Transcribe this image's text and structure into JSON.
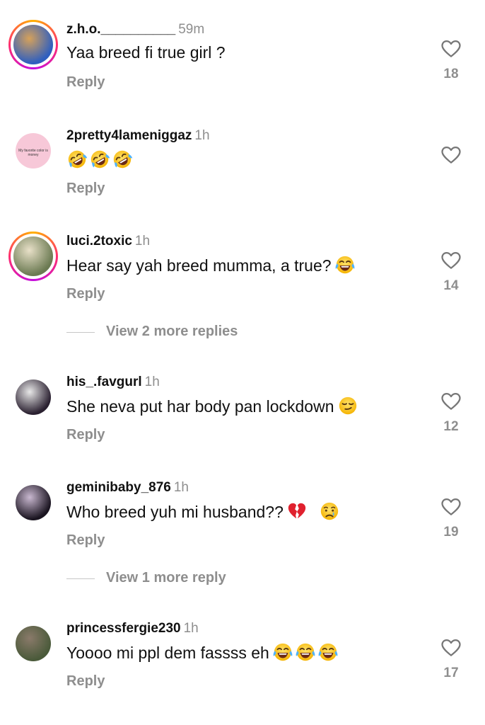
{
  "comments": [
    {
      "username": "z.h.o.__________",
      "time": "59m",
      "text": "Yaa breed fi true girl ?",
      "reply": "Reply",
      "likes": "18",
      "avatar_style": "story-ring",
      "avatar_colors": [
        "#2f5fbf",
        "#d6a15a"
      ]
    },
    {
      "username": "2pretty4lameniggaz",
      "time": "1h",
      "text": "",
      "emojis": [
        "rofl-emoji",
        "rofl-emoji",
        "rofl-emoji"
      ],
      "reply": "Reply",
      "likes": "",
      "avatar_style": "plain",
      "avatar_text": "My favorite color is money",
      "avatar_colors": [
        "#f7c8d8"
      ]
    },
    {
      "username": "luci.2toxic",
      "time": "1h",
      "text": "Hear say yah breed mumma, a true?",
      "emojis": [
        "laughing-tears-emoji"
      ],
      "reply": "Reply",
      "likes": "14",
      "avatar_style": "story-ring",
      "avatar_colors": [
        "#6b7a52",
        "#e8e0c8"
      ],
      "more_replies": "View 2 more replies"
    },
    {
      "username": "his_.favgurl",
      "time": "1h",
      "text": "She neva put har body pan lockdown",
      "emojis": [
        "smirk-emoji"
      ],
      "reply": "Reply",
      "likes": "12",
      "avatar_style": "plain",
      "avatar_colors": [
        "#2a2030",
        "#e8e8e8"
      ]
    },
    {
      "username": "geminibaby_876",
      "time": "1h",
      "text": "Who breed yuh mi husband??",
      "emojis": [
        "broken-heart-emoji",
        "crying-emoji"
      ],
      "reply": "Reply",
      "likes": "19",
      "avatar_style": "plain",
      "avatar_colors": [
        "#1a1420",
        "#c9b8d0"
      ],
      "more_replies": "View 1 more reply"
    },
    {
      "username": "princessfergie230",
      "time": "1h",
      "text": "Yoooo mi ppl dem fassss eh",
      "emojis": [
        "laughing-tears-emoji",
        "laughing-tears-emoji",
        "laughing-tears-emoji"
      ],
      "reply": "Reply",
      "likes": "17",
      "avatar_style": "plain",
      "avatar_colors": [
        "#4a5a3a",
        "#8a7a6a"
      ]
    }
  ],
  "colors": {
    "muted_text": "#8e8e8e",
    "primary_text": "#111111",
    "story_ring": [
      "#ffb100",
      "#ff2e6f",
      "#c30cde"
    ]
  }
}
